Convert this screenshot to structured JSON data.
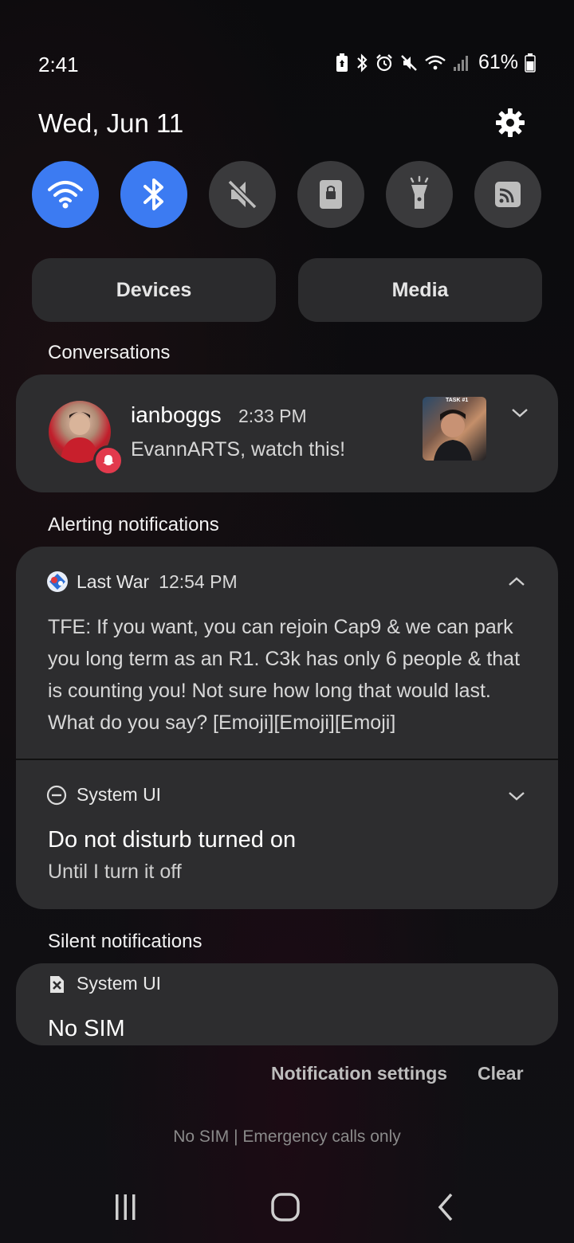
{
  "status_bar": {
    "time": "2:41",
    "battery_percent": "61%",
    "icons": [
      "battery-saver-icon",
      "bluetooth-icon",
      "alarm-icon",
      "mute-icon",
      "wifi-icon",
      "signal-icon",
      "battery-icon"
    ]
  },
  "header": {
    "date": "Wed, Jun 11",
    "settings_icon": "gear-icon"
  },
  "quick_settings": {
    "toggles": [
      {
        "name": "wifi",
        "icon": "wifi-icon",
        "state": "on"
      },
      {
        "name": "bluetooth",
        "icon": "bluetooth-icon",
        "state": "on"
      },
      {
        "name": "sound",
        "icon": "mute-icon",
        "state": "off"
      },
      {
        "name": "rotation",
        "icon": "portrait-lock-icon",
        "state": "off"
      },
      {
        "name": "flashlight",
        "icon": "flashlight-icon",
        "state": "off"
      },
      {
        "name": "cast",
        "icon": "cast-icon",
        "state": "off"
      }
    ],
    "devices_label": "Devices",
    "media_label": "Media"
  },
  "conversations": {
    "title": "Conversations",
    "item": {
      "sender": "ianboggs",
      "time": "2:33 PM",
      "message": "EvannARTS, watch this!",
      "thumbnail_label": "TASK #1"
    }
  },
  "alerting": {
    "title": "Alerting notifications",
    "last_war": {
      "app": "Last War",
      "time": "12:54 PM",
      "body": "TFE: If you want, you can rejoin Cap9 & we can park you long term as an R1.  C3k has only 6 people & that is counting you!  Not sure how long that would last.  What do you say? [Emoji][Emoji][Emoji]"
    },
    "dnd": {
      "app": "System UI",
      "title": "Do not disturb turned on",
      "subtitle": "Until I turn it off"
    }
  },
  "silent": {
    "title": "Silent notifications",
    "item": {
      "app": "System UI",
      "title": "No SIM"
    }
  },
  "footer": {
    "notification_settings": "Notification settings",
    "clear": "Clear",
    "carrier": "No SIM | Emergency calls only"
  },
  "colors": {
    "accent": "#3c7bf2",
    "card": "#2d2d2f",
    "toggle_off": "#3a3a3c"
  }
}
